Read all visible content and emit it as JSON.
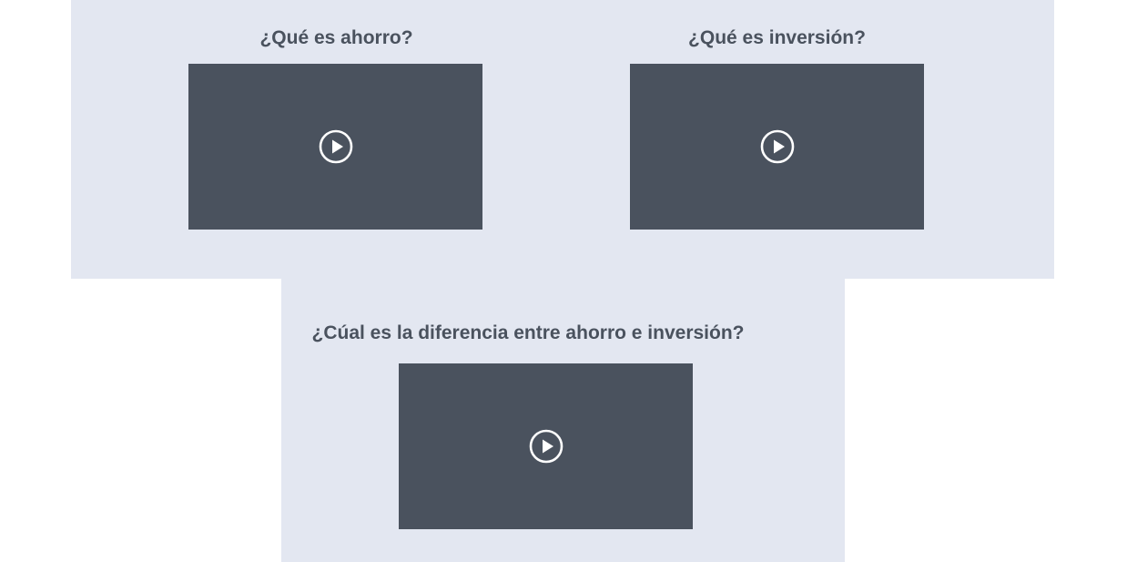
{
  "videos": [
    {
      "title": "¿Qué es ahorro?",
      "icon": "play-circle-icon"
    },
    {
      "title": "¿Qué es inversión?",
      "icon": "play-circle-icon"
    },
    {
      "title": "¿Cúal es la diferencia entre ahorro e inversión?",
      "icon": "play-circle-icon"
    }
  ],
  "colors": {
    "panel_background": "#e3e7f1",
    "video_background": "#4a525e",
    "title_text": "#4a525e",
    "icon": "#ffffff"
  }
}
